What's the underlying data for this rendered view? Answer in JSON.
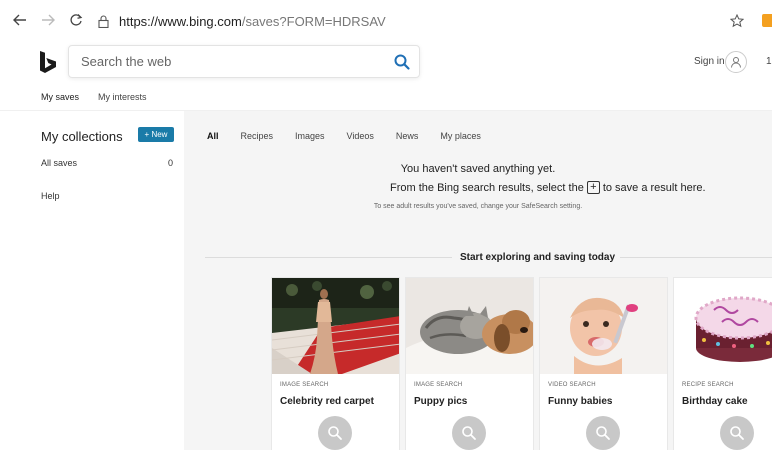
{
  "browser": {
    "url_host": "https://www.bing.com",
    "url_path": "/saves?FORM=HDRSAV"
  },
  "header": {
    "search_placeholder": "Search the web",
    "sign_in": "Sign in",
    "count": "1("
  },
  "tabs": [
    "My saves",
    "My interests"
  ],
  "sidebar": {
    "title": "My collections",
    "new_button": "+ New",
    "all_saves": "All saves",
    "all_saves_count": "0",
    "help": "Help"
  },
  "filters": [
    "All",
    "Recipes",
    "Images",
    "Videos",
    "News",
    "My places"
  ],
  "empty": {
    "line1": "You haven't saved anything yet.",
    "line2_before": "From the Bing search results, select the",
    "line2_after": "to save a result here.",
    "line3": "To see adult results you've saved, change your SafeSearch setting."
  },
  "explore": {
    "title": "Start exploring and saving today",
    "cards": [
      {
        "kind": "IMAGE SEARCH",
        "label": "Celebrity red carpet"
      },
      {
        "kind": "IMAGE SEARCH",
        "label": "Puppy pics"
      },
      {
        "kind": "VIDEO SEARCH",
        "label": "Funny babies"
      },
      {
        "kind": "RECIPE SEARCH",
        "label": "Birthday cake"
      }
    ]
  },
  "colors": {
    "accent": "#174ae4",
    "new_button": "#1a7ba8",
    "search_icon": "#1f6fb5",
    "main_bg": "#f5f5f5"
  }
}
